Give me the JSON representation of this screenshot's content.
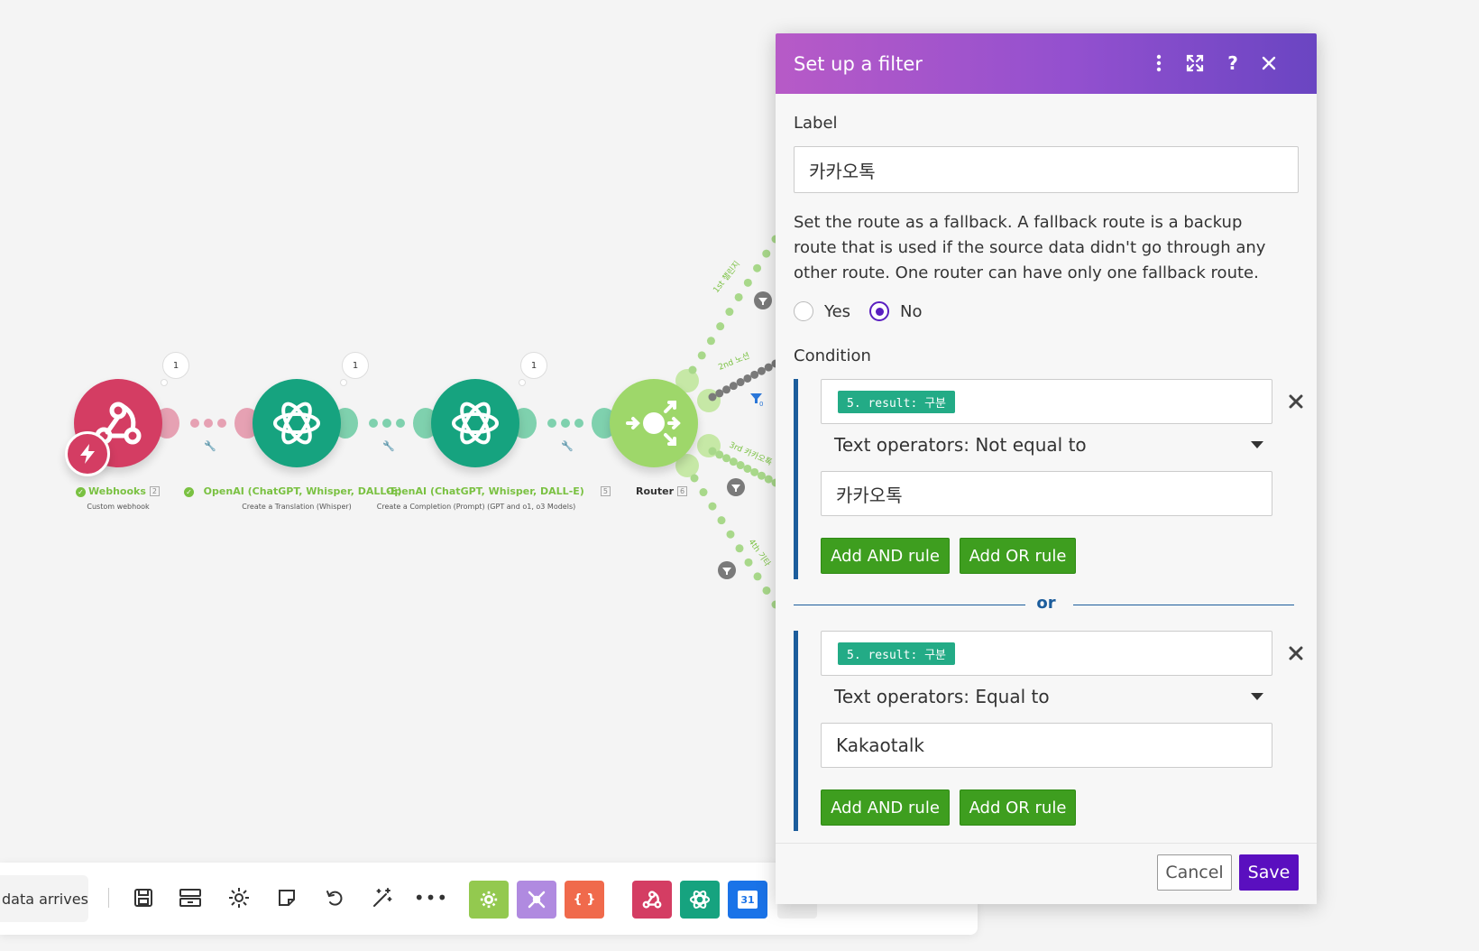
{
  "panel": {
    "title": "Set up a filter",
    "label_field": {
      "label": "Label",
      "value": "카카오톡"
    },
    "fallback": {
      "description": "Set the route as a fallback. A fallback route is a backup route that is used if the source data didn't go through any other route. One router can have only one fallback route.",
      "options": [
        {
          "label": "Yes",
          "selected": false
        },
        {
          "label": "No",
          "selected": true
        }
      ]
    },
    "condition": {
      "label": "Condition",
      "or_label": "or",
      "rules": [
        {
          "field_token": "5. result: 구분",
          "operator": "Text operators: Not equal to",
          "value": "카카오톡",
          "add_and": "Add AND rule",
          "add_or": "Add OR rule"
        },
        {
          "field_token": "5. result: 구분",
          "operator": "Text operators: Equal to",
          "value": "Kakaotalk",
          "add_and": "Add AND rule",
          "add_or": "Add OR rule"
        }
      ]
    },
    "footer": {
      "cancel": "Cancel",
      "save": "Save"
    }
  },
  "scenario": {
    "modules": [
      {
        "name": "Webhooks",
        "sub": "Custom webhook",
        "num": "2",
        "bubble": "1",
        "color": "#d43d63"
      },
      {
        "name": "OpenAI (ChatGPT, Whisper, DALL-E)",
        "sub": "Create a Translation (Whisper)",
        "bubble": "1",
        "color": "#16a37f"
      },
      {
        "name": "OpenAI (ChatGPT, Whisper, DALL-E)",
        "sub": "Create a Completion (Prompt) (GPT and o1, o3 Models)",
        "num": "5",
        "bubble": "1",
        "color": "#16a37f"
      },
      {
        "name": "Router",
        "num": "6",
        "color": "#9ed76a"
      }
    ],
    "routes": [
      {
        "label": "1st",
        "name": "챌린지"
      },
      {
        "label": "2nd",
        "name": "노션"
      },
      {
        "label": "3rd",
        "name": "카카오톡"
      },
      {
        "label": "4th",
        "name": "기타"
      }
    ],
    "route_count": "0"
  },
  "toolbar": {
    "run_label": "data arrives",
    "app_icons": [
      {
        "name": "tools-gear",
        "color": "#93c94f"
      },
      {
        "name": "flow-control",
        "color": "#b08ae0"
      },
      {
        "name": "json",
        "color": "#f06a4c"
      },
      {
        "name": "webhooks",
        "color": "#d43d63"
      },
      {
        "name": "openai",
        "color": "#16a37f"
      },
      {
        "name": "calendar",
        "color": "#1a73e8",
        "text": "31"
      }
    ]
  }
}
